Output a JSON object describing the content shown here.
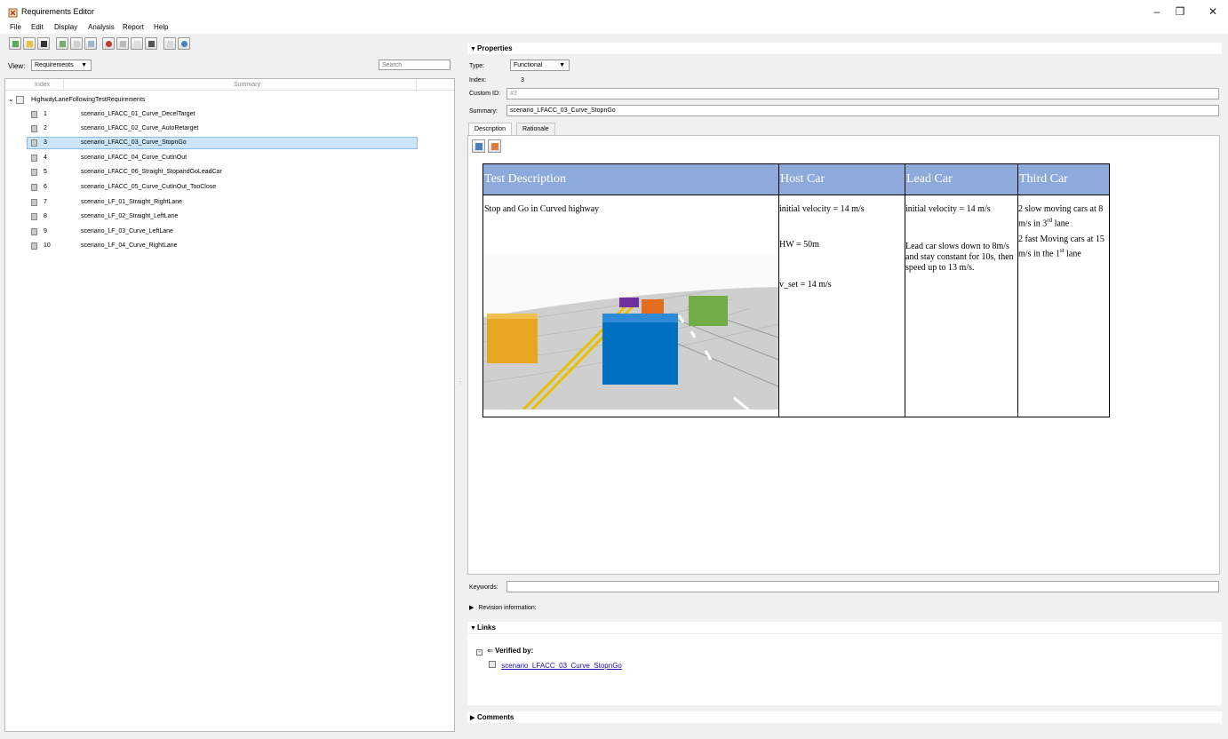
{
  "window": {
    "title": "Requirements Editor",
    "controls": {
      "minimize": "–",
      "restore": "❐",
      "close": "✕"
    }
  },
  "menu": [
    "File",
    "Edit",
    "Display",
    "Analysis",
    "Report",
    "Help"
  ],
  "toolbar": {
    "icons": [
      "new-requirement-set-icon",
      "open-icon",
      "save-icon",
      "add-requirement-icon",
      "add-child-requirement-icon",
      "add-justification-icon",
      "cut-icon",
      "copy-icon",
      "paste-icon",
      "delete-icon",
      "undo-icon",
      "refresh-icon"
    ]
  },
  "view": {
    "label": "View:",
    "selected": "Requirements",
    "search_placeholder": "Search"
  },
  "tree": {
    "columns": {
      "index": "Index",
      "summary": "Summary"
    },
    "root": "HighwayLaneFollowingTestRequirements",
    "rows": [
      {
        "index": "1",
        "summary": "scenario_LFACC_01_Curve_DecelTarget"
      },
      {
        "index": "2",
        "summary": "scenario_LFACC_02_Curve_AutoRetarget"
      },
      {
        "index": "3",
        "summary": "scenario_LFACC_03_Curve_StopnGo"
      },
      {
        "index": "4",
        "summary": "scenario_LFACC_04_Curve_CutInOut"
      },
      {
        "index": "5",
        "summary": "scenario_LFACC_06_Straight_StopandGoLeadCar"
      },
      {
        "index": "6",
        "summary": "scenario_LFACC_05_Curve_CutInOut_TooClose"
      },
      {
        "index": "7",
        "summary": "scenario_LF_01_Straight_RightLane"
      },
      {
        "index": "8",
        "summary": "scenario_LF_02_Straight_LeftLane"
      },
      {
        "index": "9",
        "summary": "scenario_LF_03_Curve_LeftLane"
      },
      {
        "index": "10",
        "summary": "scenario_LF_04_Curve_RightLane"
      }
    ],
    "selected_index": "3"
  },
  "properties": {
    "title": "Properties",
    "type_label": "Type:",
    "type_value": "Functional",
    "index_label": "Index:",
    "index_value": "3",
    "custom_id_label": "Custom ID:",
    "custom_id_value": "#3",
    "summary_label": "Summary:",
    "summary_value": "scenario_LFACC_03_Curve_StopnGo",
    "tabs": [
      "Description",
      "Rationale"
    ],
    "active_tab": "Description"
  },
  "description_table": {
    "headers": [
      "Test Description",
      "Host Car",
      "Lead Car",
      "Third Car"
    ],
    "test_description": "Stop and Go in Curved highway",
    "host_car": [
      "initial velocity = 14 m/s",
      "HW = 50m",
      "v_set  =  14 m/s"
    ],
    "lead_car": [
      "initial velocity = 14 m/s",
      "Lead car slows down to 8m/s and stay constant for 10s, then speed up to 13 m/s."
    ],
    "third_car": {
      "line1_prefix": "2 slow moving cars at 8 m/s in 3",
      "line1_sup": "rd",
      "line1_suffix": " lane",
      "line2_prefix": "2 fast Moving cars at 15 m/s in the 1",
      "line2_sup": "st",
      "line2_suffix": " lane"
    },
    "colors": {
      "header_bg": "#8eaadb",
      "ego_car": "#0070c0",
      "left_car": "#e6a621",
      "green_car": "#70ad47",
      "orange_car": "#e46c1e",
      "purple_car": "#7030a0"
    }
  },
  "keywords_label": "Keywords:",
  "revision_label": "Revision information:",
  "links": {
    "title": "Links",
    "verified_by": "Verified by:",
    "item": "scenario_LFACC_03_Curve_StopnGo"
  },
  "comments_title": "Comments"
}
